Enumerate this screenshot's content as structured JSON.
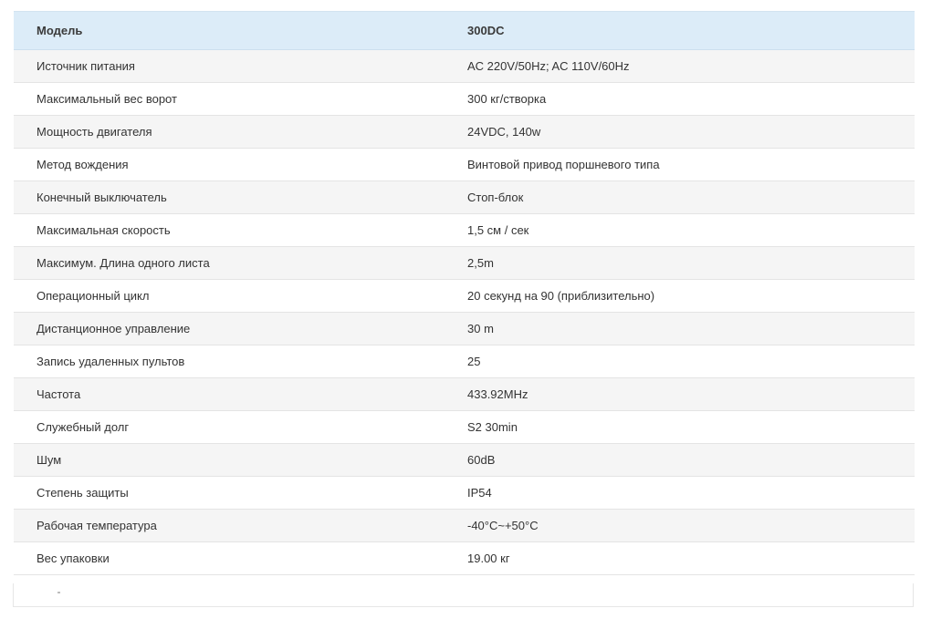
{
  "table": {
    "header": {
      "label": "Модель",
      "value": "300DC"
    },
    "rows": [
      {
        "label": "Источник питания",
        "value": "AC 220V/50Hz; AC 110V/60Hz"
      },
      {
        "label": "Максимальный вес ворот",
        "value": "300 кг/створка"
      },
      {
        "label": "Мощность двигателя",
        "value": "24VDC, 140w"
      },
      {
        "label": "Метод вождения",
        "value": "Винтовой привод поршневого типа"
      },
      {
        "label": "Конечный выключатель",
        "value": "Стоп-блок"
      },
      {
        "label": "Максимальная скорость",
        "value": "1,5 см / сек"
      },
      {
        "label": "Максимум. Длина одного листа",
        "value": "2,5m"
      },
      {
        "label": "Операционный цикл",
        "value": "20 секунд на 90 (приблизительно)"
      },
      {
        "label": "Дистанционное управление",
        "value": "30 m"
      },
      {
        "label": "Запись удаленных пультов",
        "value": "25"
      },
      {
        "label": "Частота",
        "value": "433.92MHz"
      },
      {
        "label": "Служебный долг",
        "value": "S2 30min"
      },
      {
        "label": "Шум",
        "value": "60dB"
      },
      {
        "label": "Степень защиты",
        "value": "IP54"
      },
      {
        "label": "Рабочая температура",
        "value": "-40°C~+50°C"
      },
      {
        "label": "Вес упаковки",
        "value": "19.00 кг"
      }
    ]
  },
  "colors": {
    "header_bg": "#dcecf8",
    "row_odd_bg": "#f5f5f5",
    "row_even_bg": "#ffffff",
    "text": "#333333"
  }
}
